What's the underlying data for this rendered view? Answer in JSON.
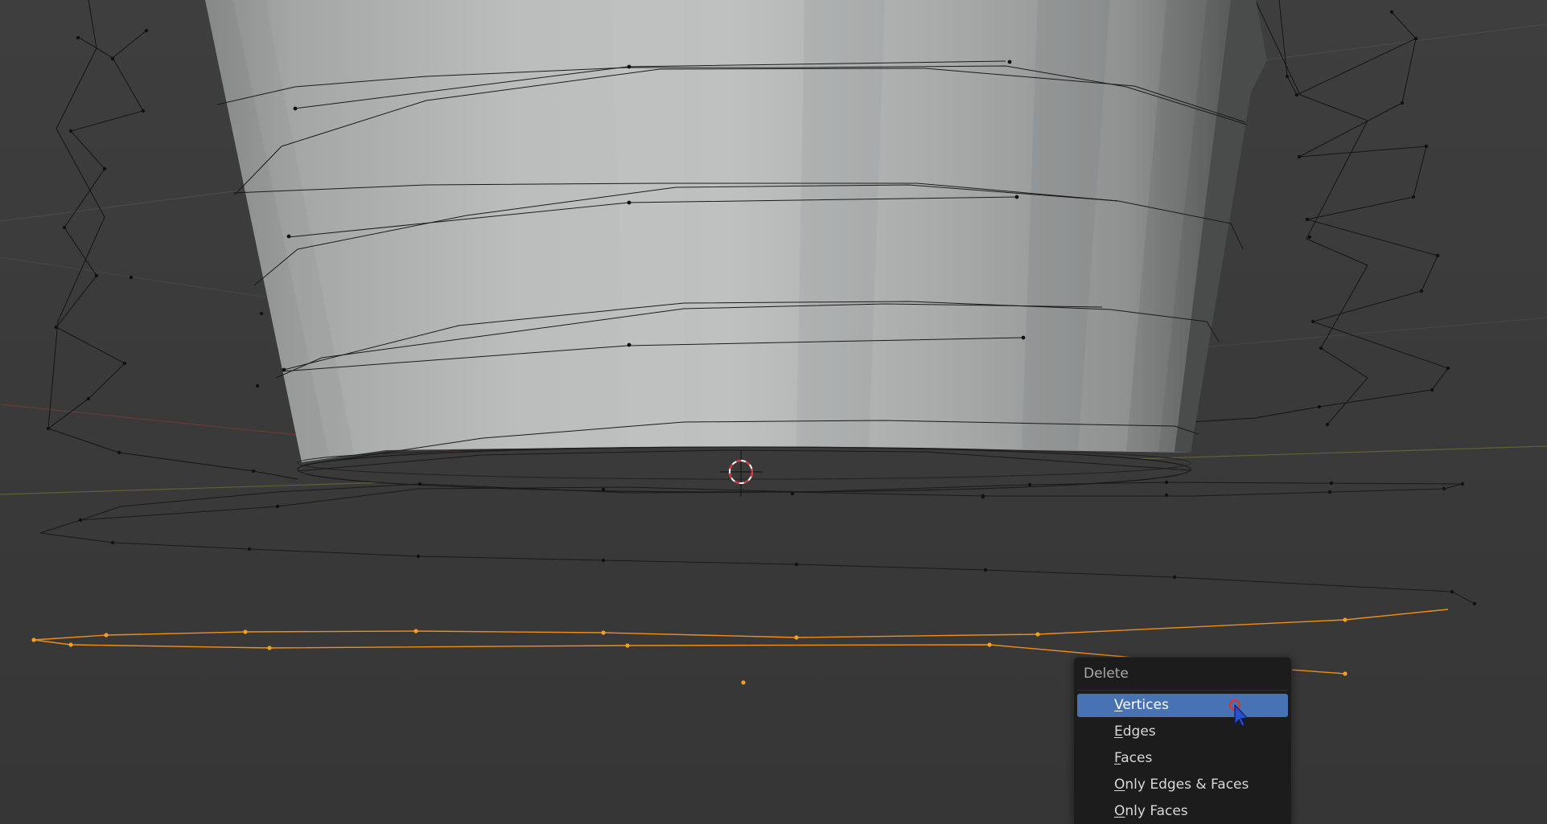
{
  "app": "Blender 3D Viewport (Edit Mode)",
  "colors": {
    "viewport_bg": "#3d3d3d",
    "selected_orange": "#f08d1a",
    "mesh_wire": "#111111",
    "menu_bg": "#1c1c1c",
    "menu_highlight": "#4772b3",
    "cursor_red": "#e03030"
  },
  "delete_menu": {
    "title": "Delete",
    "items": [
      {
        "mnemonic": "V",
        "rest": "ertices",
        "active": true
      },
      {
        "mnemonic": "E",
        "rest": "dges",
        "active": false
      },
      {
        "mnemonic": "F",
        "rest": "aces",
        "active": false
      },
      {
        "mnemonic": "O",
        "rest": "nly Edges & Faces",
        "active": false
      },
      {
        "mnemonic": "O",
        "rest": "nly Faces",
        "active": false
      }
    ]
  },
  "icons": {
    "cursor_3d": "3d-cursor-icon",
    "mouse_pointer": "mouse-pointer-icon"
  }
}
